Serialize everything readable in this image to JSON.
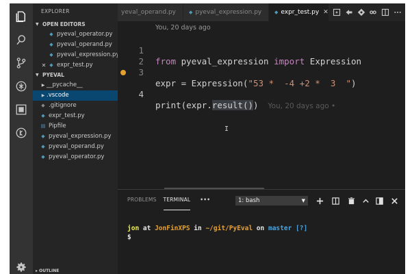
{
  "sidebar": {
    "header": "EXPLORER",
    "open_editors": {
      "title": "OPEN EDITORS",
      "items": [
        {
          "label": "pyeval_operator.py"
        },
        {
          "label": "pyeval_operand.py"
        },
        {
          "label": "pyeval_expression.py"
        },
        {
          "label": "expr_test.py",
          "close": "✕"
        }
      ]
    },
    "project": {
      "title": "PYEVAL",
      "items": [
        {
          "label": "__pycache__"
        },
        {
          "label": ".vscode"
        },
        {
          "label": ".gitignore"
        },
        {
          "label": "expr_test.py"
        },
        {
          "label": "Pipfile"
        },
        {
          "label": "pyeval_expression.py"
        },
        {
          "label": "pyeval_operand.py"
        },
        {
          "label": "pyeval_operator.py"
        }
      ]
    },
    "outline_title": "OUTLINE"
  },
  "tabs": [
    {
      "label": "yeval_operand.py"
    },
    {
      "label": "pyeval_expression.py"
    },
    {
      "label": "expr_test.py",
      "close": "✕"
    }
  ],
  "editor": {
    "codelens": "You, 20 days ago",
    "lines": [
      {
        "num": "1",
        "parts": [
          "from",
          " pyeval_expression ",
          "import",
          " Expression"
        ]
      },
      {
        "num": "2",
        "parts": [
          ""
        ]
      },
      {
        "num": "3",
        "parts": [
          "expr = Expression(",
          "\"53 *  -4 +2 *  3  \"",
          ")"
        ]
      },
      {
        "num": "4",
        "parts": [
          "print(expr.",
          "result()",
          ")"
        ],
        "blame": "You, 20 days ago •"
      }
    ],
    "ibeam": "I"
  },
  "panel": {
    "tabs": [
      "PROBLEMS",
      "TERMINAL",
      "•••"
    ],
    "terminal_select": "1: bash",
    "terminal": {
      "user": "jon",
      "at": " at ",
      "host": "JonFinXPS",
      "in": " in ",
      "path": "~/git/PyEval",
      "on": " on ",
      "branch": "master",
      "status": "[?]",
      "prompt": "$"
    }
  },
  "colors": {
    "activity_bar": "#333333",
    "sidebar": "#252526",
    "editor": "#1e1e1e",
    "selection": "#094771",
    "keyword": "#c586c0",
    "string": "#ce9178",
    "modified_dot": "#e5a032"
  }
}
